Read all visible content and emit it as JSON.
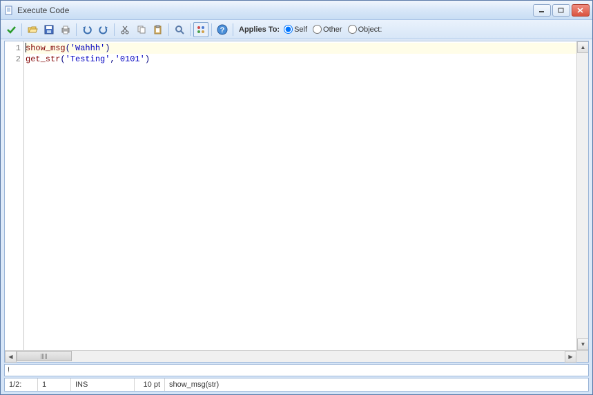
{
  "window": {
    "title": "Execute Code"
  },
  "toolbar": {
    "applies_to_label": "Applies To:",
    "radio": {
      "self": "Self",
      "other": "Other",
      "object": "Object:",
      "selected": "self"
    }
  },
  "editor": {
    "lines": [
      {
        "n": "1",
        "func": "show_msg",
        "open": "(",
        "arg": "'Wahhh'",
        "close": ")"
      },
      {
        "n": "2",
        "func": "get_str",
        "open": "(",
        "arg1": "'Testing'",
        "comma": ",",
        "arg2": "'0101'",
        "close": ")"
      }
    ]
  },
  "msgbar": {
    "text": "!"
  },
  "status": {
    "pos": "1/2:",
    "col": "1",
    "mode": "INS",
    "font": "10 pt",
    "hint": "show_msg(str)"
  }
}
